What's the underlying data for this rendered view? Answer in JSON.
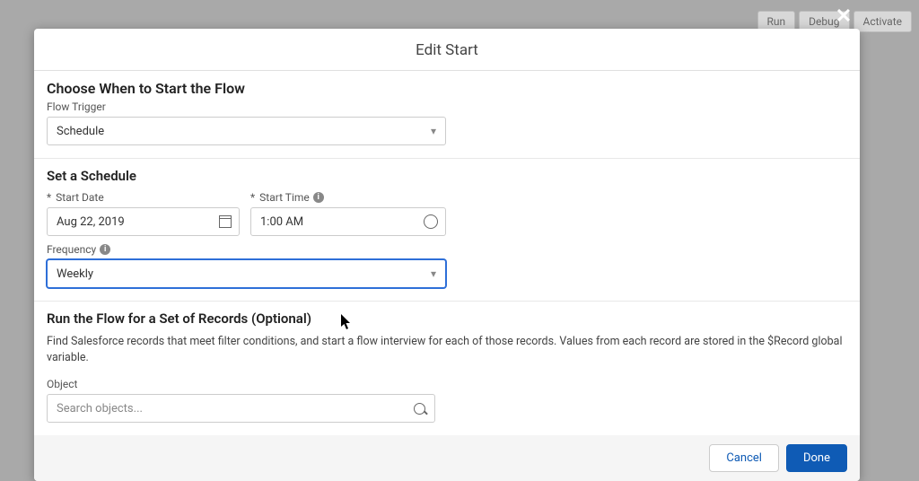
{
  "background_buttons": {
    "run": "Run",
    "debug": "Debug",
    "activate": "Activate"
  },
  "modal": {
    "title": "Edit Start",
    "section1": {
      "title": "Choose When to Start the Flow",
      "flow_trigger_label": "Flow Trigger",
      "flow_trigger_value": "Schedule"
    },
    "section2": {
      "title": "Set a Schedule",
      "start_date_label": "Start Date",
      "start_date_value": "Aug 22, 2019",
      "start_time_label": "Start Time",
      "start_time_value": "1:00 AM",
      "frequency_label": "Frequency",
      "frequency_value": "Weekly"
    },
    "section3": {
      "title": "Run the Flow for a Set of Records (Optional)",
      "description": "Find Salesforce records that meet filter conditions, and start a flow interview for each of those records. Values from each record are stored in the $Record global variable.",
      "object_label": "Object",
      "object_placeholder": "Search objects..."
    },
    "footer": {
      "cancel": "Cancel",
      "done": "Done"
    }
  }
}
